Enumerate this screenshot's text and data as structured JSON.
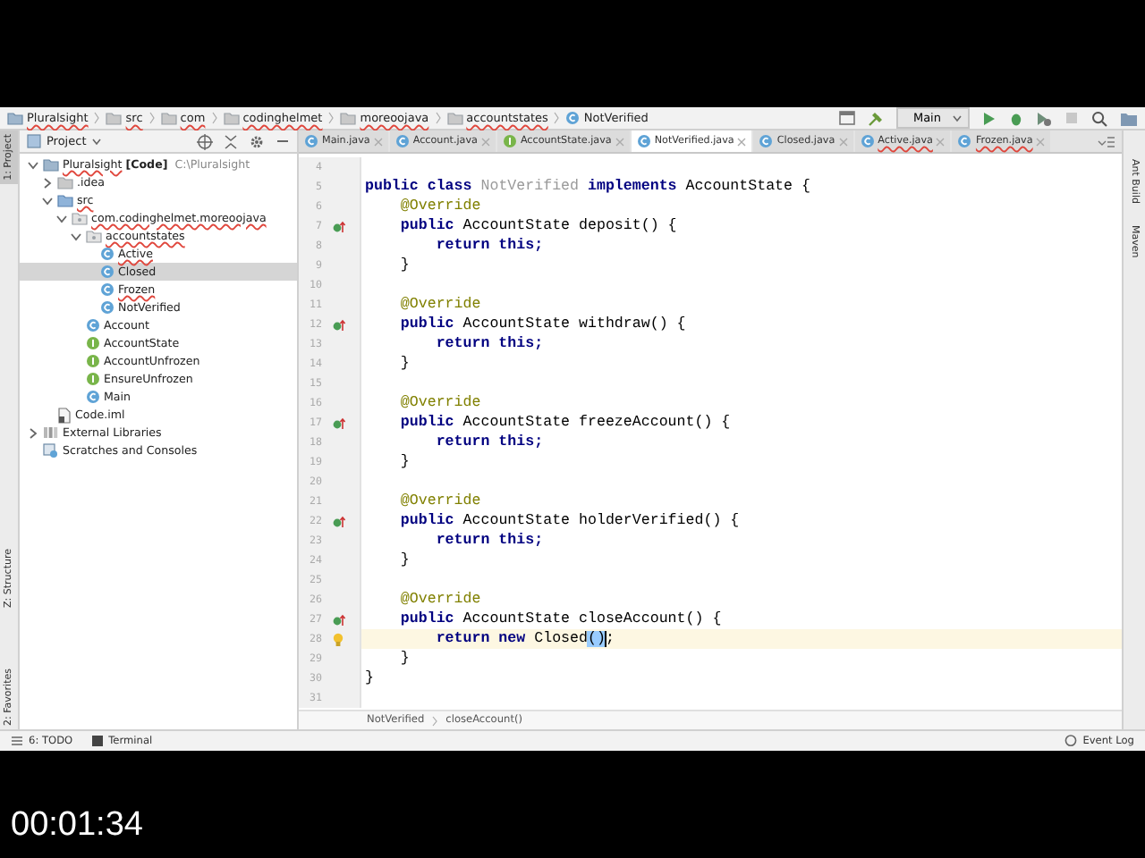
{
  "navigation_bar": {
    "crumbs": [
      {
        "label": "Pluralsight",
        "kind": "project",
        "error": true
      },
      {
        "label": "src",
        "kind": "folder",
        "error": true
      },
      {
        "label": "com",
        "kind": "folder",
        "error": true
      },
      {
        "label": "codinghelmet",
        "kind": "folder",
        "error": true
      },
      {
        "label": "moreoojava",
        "kind": "folder",
        "error": true
      },
      {
        "label": "accountstates",
        "kind": "folder",
        "error": true
      },
      {
        "label": "NotVerified",
        "kind": "class",
        "error": false
      }
    ],
    "run_configuration": "Main"
  },
  "left_stripe": [
    "1: Project",
    "Z: Structure",
    "2: Favorites"
  ],
  "right_stripe": [
    "Ant Build",
    "Maven"
  ],
  "project_panel": {
    "title": "Project",
    "tree": [
      {
        "label": "Pluralsight",
        "tag": "[Code]",
        "path": "C:\\Pluralsight",
        "kind": "project",
        "error": true,
        "expanded": true,
        "selected": false,
        "children": [
          {
            "label": ".idea",
            "kind": "folder",
            "error": false,
            "expanded": false,
            "selected": false
          },
          {
            "label": "src",
            "kind": "source",
            "error": true,
            "expanded": true,
            "selected": false,
            "children": [
              {
                "label": "com.codinghelmet.moreoojava",
                "kind": "package",
                "error": true,
                "expanded": true,
                "selected": false,
                "children": [
                  {
                    "label": "accountstates",
                    "kind": "package",
                    "error": true,
                    "expanded": true,
                    "selected": false,
                    "children": [
                      {
                        "label": "Active",
                        "kind": "class",
                        "error": true,
                        "selected": false
                      },
                      {
                        "label": "Closed",
                        "kind": "class",
                        "error": false,
                        "selected": true
                      },
                      {
                        "label": "Frozen",
                        "kind": "class",
                        "error": true,
                        "selected": false
                      },
                      {
                        "label": "NotVerified",
                        "kind": "class",
                        "error": false,
                        "selected": false
                      }
                    ]
                  },
                  {
                    "label": "Account",
                    "kind": "class",
                    "error": false,
                    "selected": false
                  },
                  {
                    "label": "AccountState",
                    "kind": "interface",
                    "error": false,
                    "selected": false
                  },
                  {
                    "label": "AccountUnfrozen",
                    "kind": "interface",
                    "error": false,
                    "selected": false
                  },
                  {
                    "label": "EnsureUnfrozen",
                    "kind": "interface",
                    "error": false,
                    "selected": false
                  },
                  {
                    "label": "Main",
                    "kind": "class",
                    "error": false,
                    "selected": false
                  }
                ]
              }
            ]
          },
          {
            "label": "Code.iml",
            "kind": "file",
            "error": false,
            "selected": false
          }
        ]
      },
      {
        "label": "External Libraries",
        "kind": "library",
        "error": false,
        "expanded": false,
        "selected": false
      },
      {
        "label": "Scratches and Consoles",
        "kind": "scratches",
        "error": false,
        "selected": false
      }
    ]
  },
  "tabs": [
    {
      "label": "Main.java",
      "kind": "class",
      "selected": false,
      "error": false
    },
    {
      "label": "Account.java",
      "kind": "class",
      "selected": false,
      "error": false
    },
    {
      "label": "AccountState.java",
      "kind": "interface",
      "selected": false,
      "error": false
    },
    {
      "label": "NotVerified.java",
      "kind": "class",
      "selected": true,
      "error": false
    },
    {
      "label": "Closed.java",
      "kind": "class",
      "selected": false,
      "error": false
    },
    {
      "label": "Active.java",
      "kind": "class",
      "selected": false,
      "error": true
    },
    {
      "label": "Frozen.java",
      "kind": "class",
      "selected": false,
      "error": true
    }
  ],
  "code": [
    {
      "number": "4"
    },
    {
      "number": "5",
      "tokens": [
        {
          "text": "public class ",
          "kind": "keyword"
        },
        {
          "text": "NotVerified",
          "kind": "unused"
        },
        {
          "text": " implements ",
          "kind": "keyword"
        },
        {
          "text": "AccountState {",
          "kind": "plain"
        }
      ]
    },
    {
      "number": "6",
      "tokens": [
        {
          "text": "    @Override",
          "kind": "annotation"
        }
      ]
    },
    {
      "number": "7",
      "override": true,
      "tokens": [
        {
          "text": "    public ",
          "kind": "keyword"
        },
        {
          "text": "AccountState deposit() {",
          "kind": "plain"
        }
      ]
    },
    {
      "number": "8",
      "tokens": [
        {
          "text": "        return this;",
          "kind": "keyword"
        }
      ]
    },
    {
      "number": "9",
      "tokens": [
        {
          "text": "    }",
          "kind": "plain"
        }
      ]
    },
    {
      "number": "10"
    },
    {
      "number": "11",
      "tokens": [
        {
          "text": "    @Override",
          "kind": "annotation"
        }
      ]
    },
    {
      "number": "12",
      "override": true,
      "tokens": [
        {
          "text": "    public ",
          "kind": "keyword"
        },
        {
          "text": "AccountState withdraw() {",
          "kind": "plain"
        }
      ]
    },
    {
      "number": "13",
      "tokens": [
        {
          "text": "        return this;",
          "kind": "keyword"
        }
      ]
    },
    {
      "number": "14",
      "tokens": [
        {
          "text": "    }",
          "kind": "plain"
        }
      ]
    },
    {
      "number": "15"
    },
    {
      "number": "16",
      "tokens": [
        {
          "text": "    @Override",
          "kind": "annotation"
        }
      ]
    },
    {
      "number": "17",
      "override": true,
      "tokens": [
        {
          "text": "    public ",
          "kind": "keyword"
        },
        {
          "text": "AccountState freezeAccount() {",
          "kind": "plain"
        }
      ]
    },
    {
      "number": "18",
      "tokens": [
        {
          "text": "        return this;",
          "kind": "keyword"
        }
      ]
    },
    {
      "number": "19",
      "tokens": [
        {
          "text": "    }",
          "kind": "plain"
        }
      ]
    },
    {
      "number": "20"
    },
    {
      "number": "21",
      "tokens": [
        {
          "text": "    @Override",
          "kind": "annotation"
        }
      ]
    },
    {
      "number": "22",
      "override": true,
      "tokens": [
        {
          "text": "    public ",
          "kind": "keyword"
        },
        {
          "text": "AccountState holderVerified() {",
          "kind": "plain"
        }
      ]
    },
    {
      "number": "23",
      "tokens": [
        {
          "text": "        return this;",
          "kind": "keyword"
        }
      ]
    },
    {
      "number": "24",
      "tokens": [
        {
          "text": "    }",
          "kind": "plain"
        }
      ]
    },
    {
      "number": "25"
    },
    {
      "number": "26",
      "tokens": [
        {
          "text": "    @Override",
          "kind": "annotation"
        }
      ]
    },
    {
      "number": "27",
      "override": true,
      "tokens": [
        {
          "text": "    public ",
          "kind": "keyword"
        },
        {
          "text": "AccountState closeAccount() {",
          "kind": "plain"
        }
      ]
    },
    {
      "number": "28",
      "current": true,
      "bulb": true,
      "tokens": [
        {
          "text": "        return new ",
          "kind": "keyword"
        },
        {
          "text": "Closed",
          "kind": "plain"
        },
        {
          "text": "()",
          "kind": "match"
        },
        {
          "text": ";",
          "kind": "plain"
        }
      ]
    },
    {
      "number": "29",
      "tokens": [
        {
          "text": "    }",
          "kind": "plain"
        }
      ]
    },
    {
      "number": "30",
      "tokens": [
        {
          "text": "}",
          "kind": "plain"
        }
      ]
    },
    {
      "number": "31"
    }
  ],
  "editor_breadcrumb": [
    "NotVerified",
    "closeAccount()"
  ],
  "bottom_bar": {
    "tools": [
      "6: TODO",
      "Terminal"
    ],
    "event_log": "Event Log"
  },
  "video_time": "00:01:34"
}
